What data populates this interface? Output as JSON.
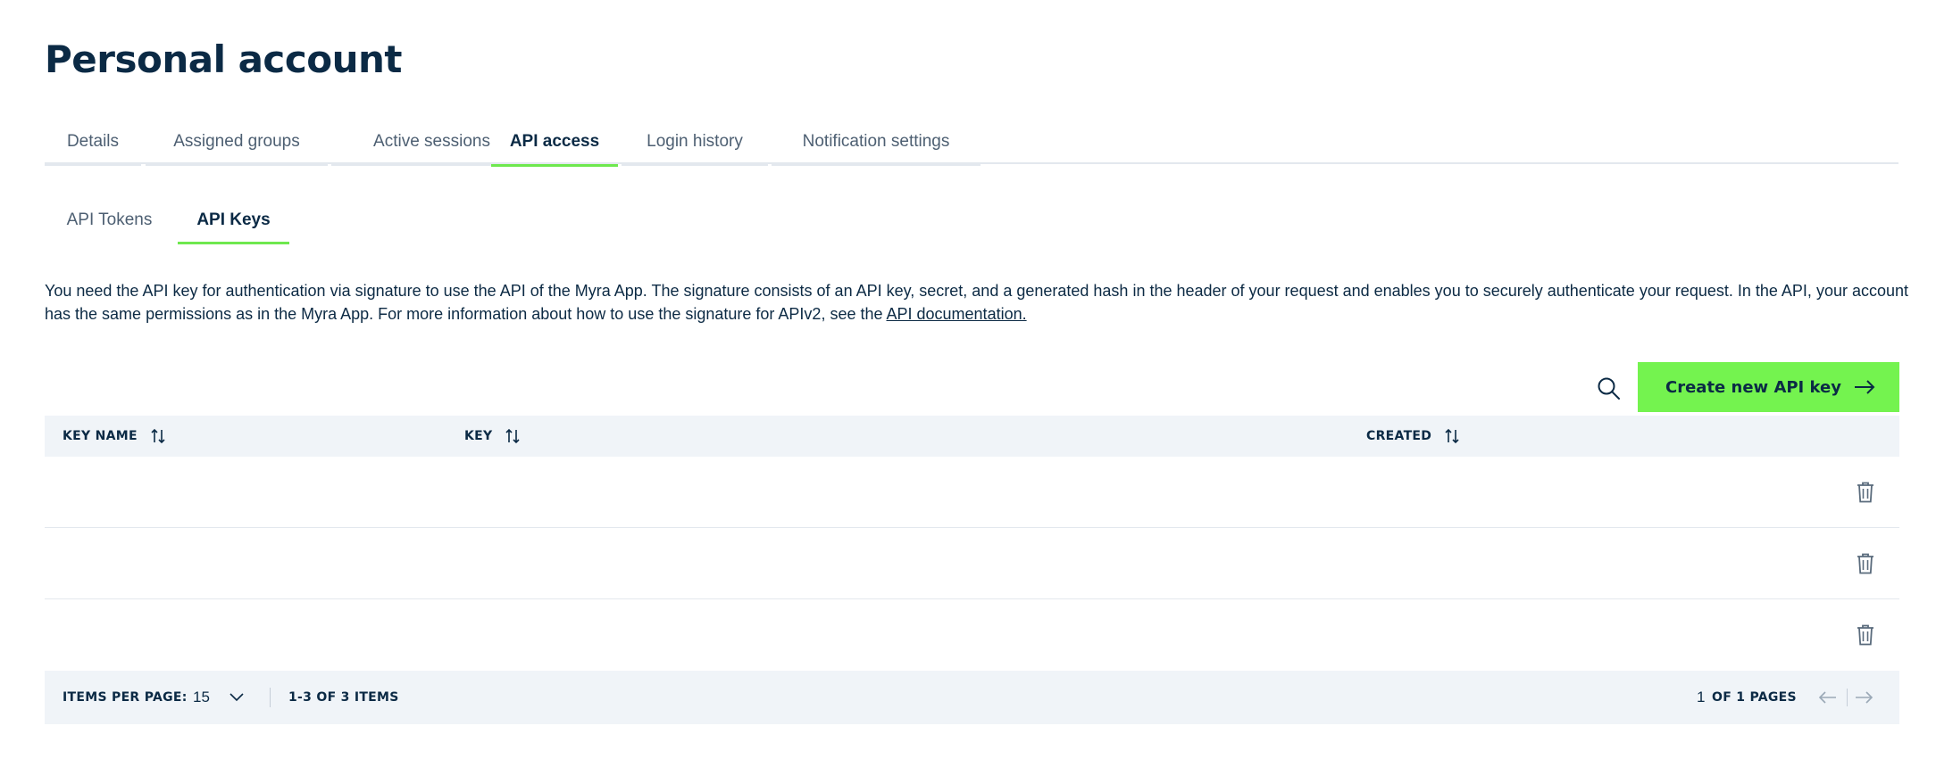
{
  "page": {
    "title": "Personal account"
  },
  "tabs": [
    {
      "label": "Details"
    },
    {
      "label": "Assigned groups"
    },
    {
      "label": "Active sessions"
    },
    {
      "label": "API access",
      "active": true
    },
    {
      "label": "Login history"
    },
    {
      "label": "Notification settings"
    }
  ],
  "subtabs": [
    {
      "label": "API Tokens"
    },
    {
      "label": "API Keys",
      "active": true
    }
  ],
  "description": {
    "text": "You need the API key for authentication via signature to use the API of the Myra App. The signature consists of an API key, secret, and a generated hash in the header of your request and enables you to securely authenticate your request. In the API, your account has the same permissions as in the Myra App. For more information about how to use the signature for APIv2, see the ",
    "link": "API documentation."
  },
  "toolbar": {
    "search_icon": "search-icon",
    "create_label": "Create new API key",
    "create_icon": "arrow-right-icon"
  },
  "table": {
    "columns": [
      {
        "label": "KEY NAME"
      },
      {
        "label": "KEY"
      },
      {
        "label": "CREATED"
      }
    ],
    "rows": [
      {
        "key_name": "",
        "key": "",
        "created": ""
      },
      {
        "key_name": "",
        "key": "",
        "created": ""
      },
      {
        "key_name": "",
        "key": "",
        "created": ""
      }
    ]
  },
  "footer": {
    "items_per_page_label": "ITEMS PER PAGE:",
    "items_per_page_value": "15",
    "range_text": "1-3 OF 3 ITEMS",
    "current_page": "1",
    "pages_text": "OF 1 PAGES"
  },
  "colors": {
    "accent": "#74f34f",
    "tab_underline": "#6ee84e",
    "text": "#0b2a45",
    "header_bg": "#f0f4f8"
  }
}
